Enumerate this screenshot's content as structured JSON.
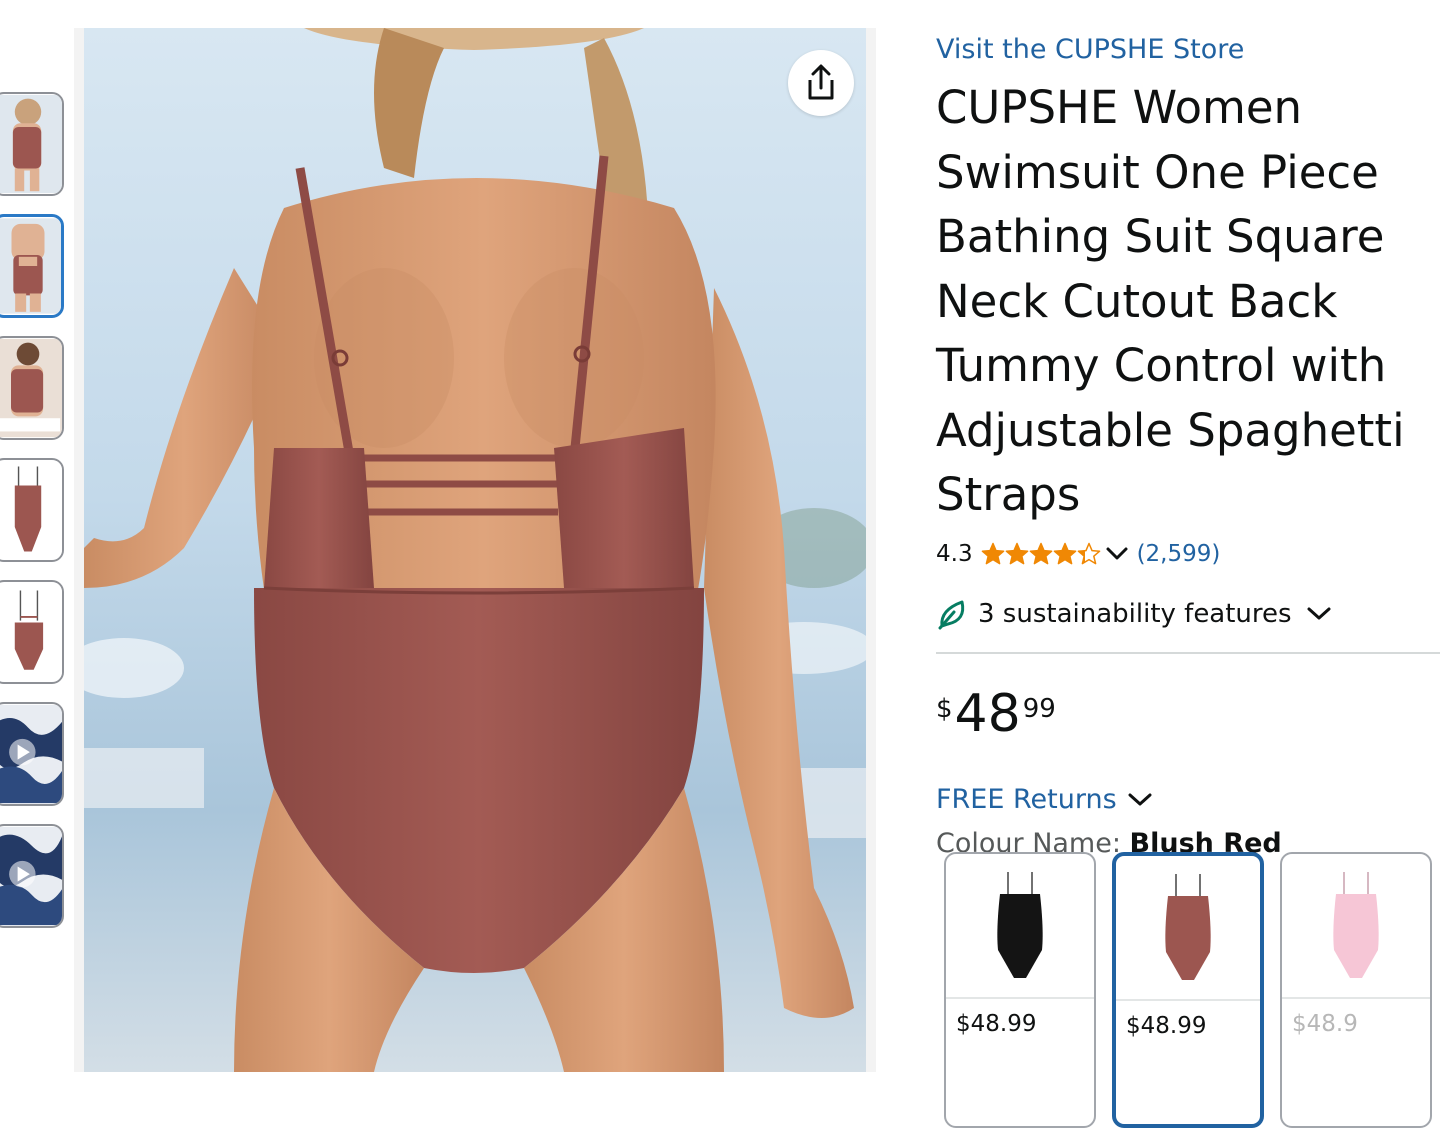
{
  "product": {
    "store_link": "Visit the CUPSHE Store",
    "title": "CUPSHE Women Swimsuit One Piece Bathing Suit Square Neck Cutout Back Tummy Control with Adjustable Spaghetti Straps",
    "rating": "4.3",
    "rating_value": 4.3,
    "rating_max": 5,
    "review_count": "(2,599)",
    "sustainability": "3 sustainability features",
    "price": {
      "symbol": "$",
      "whole": "48",
      "fraction": "99"
    },
    "returns": "FREE Returns",
    "colour_label": "Colour Name:",
    "colour_value": "Blush Red"
  },
  "swatches": [
    {
      "name": "black",
      "price": "$48.99",
      "color": "#141414"
    },
    {
      "name": "blush-red",
      "price": "$48.99",
      "color": "#9c5650",
      "selected": true
    },
    {
      "name": "pink",
      "price": "$48.9",
      "color": "#f6c6d6"
    }
  ],
  "thumbnails": [
    {
      "name": "thumb-1",
      "type": "image"
    },
    {
      "name": "thumb-2",
      "type": "image",
      "selected": true
    },
    {
      "name": "thumb-3",
      "type": "image"
    },
    {
      "name": "thumb-4",
      "type": "image"
    },
    {
      "name": "thumb-5",
      "type": "image"
    },
    {
      "name": "thumb-6",
      "type": "video"
    },
    {
      "name": "thumb-7",
      "type": "video"
    }
  ],
  "colors": {
    "link": "#2162a1",
    "star": "#f08804",
    "selected_border": "#2162a1",
    "leaf": "#067d62",
    "swimsuit": "#9c5650"
  },
  "icons": [
    "share-icon",
    "star-icon",
    "chevron-down-icon",
    "leaf-icon",
    "play-icon"
  ]
}
